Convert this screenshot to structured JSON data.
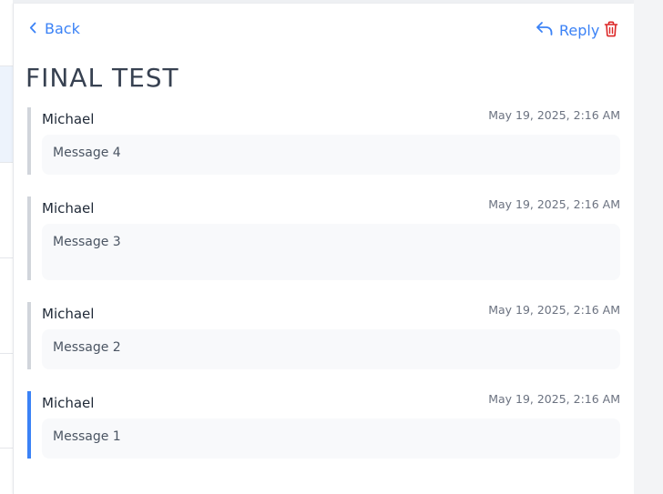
{
  "toolbar": {
    "back_label": "Back",
    "reply_label": "Reply"
  },
  "thread": {
    "subject": "FINAL TEST",
    "messages": [
      {
        "sender": "Michael",
        "date": "May 19, 2025, 2:16 AM",
        "body": "Message 4"
      },
      {
        "sender": "Michael",
        "date": "May 19, 2025, 2:16 AM",
        "body": "Message 3"
      },
      {
        "sender": "Michael",
        "date": "May 19, 2025, 2:16 AM",
        "body": "Message 2"
      },
      {
        "sender": "Michael",
        "date": "May 19, 2025, 2:16 AM",
        "body": "Message 1"
      }
    ]
  },
  "colors": {
    "accent": "#3b82f6",
    "danger": "#dc2626",
    "thread_border": "#d1d5db",
    "latest_border": "#3b82f6"
  },
  "icons": {
    "back": "chevron-left-icon",
    "reply": "reply-arrow-icon",
    "delete": "trash-icon"
  }
}
